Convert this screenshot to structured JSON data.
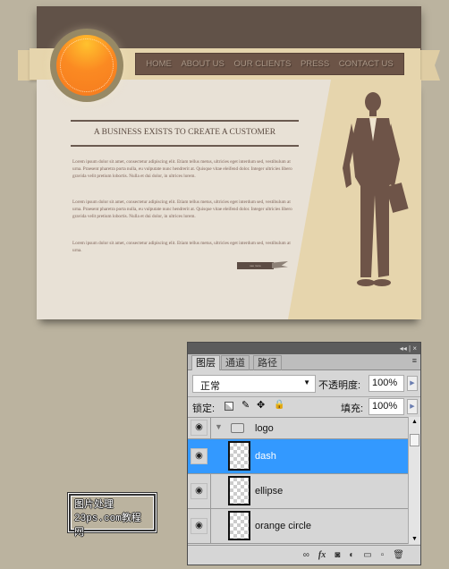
{
  "site": {
    "nav": [
      "HOME",
      "ABOUT US",
      "OUR CLIENTS",
      "PRESS",
      "CONTACT US"
    ],
    "heading": "A BUSINESS EXISTS TO CREATE A CUSTOMER",
    "paragraphs": [
      "Lorem ipsum dolor sit amet, consectetur adipiscing elit. Etiam tellus metus, ultricies eget interdum sed, vestibulum at urna. Praesent pharetra porta nulla, eu vulputate nunc hendrerit at. Quisque vitae eleifend dolor. Integer ultricies libero gravida velit pretium lobortis. Nulla et dui dolor, in ultrices lorem.",
      "Lorem ipsum dolor sit amet, consectetur adipiscing elit. Etiam tellus metus, ultricies eget interdum sed, vestibulum at urna. Praesent pharetra porta nulla, eu vulputate nunc hendrerit at. Quisque vitae eleifend dolor. Integer ultricies libero gravida velit pretium lobortis. Nulla et dui dolor, in ultrices lorem.",
      "Lorem ipsum dolor sit amet, consectetur adipiscing elit. Etiam tellus metus, ultricies eget interdum sed, vestibulum at urna."
    ],
    "button": "see more",
    "colors": {
      "header": "#615248",
      "ribbon": "#e6d5ad",
      "body": "#e8e1d6",
      "logo": "#f98522"
    }
  },
  "panel": {
    "titlebar": "◂◂ | ×",
    "tabs": [
      "图层",
      "通道",
      "路径"
    ],
    "menu_icon": "≡",
    "blend_mode": "正常",
    "opacity_label": "不透明度:",
    "opacity": "100%",
    "lock_label": "锁定:",
    "lock_icons": [
      "transparent-pixels",
      "brush",
      "move",
      "lock"
    ],
    "fill_label": "填充:",
    "fill": "100%",
    "layers": [
      {
        "name": "logo",
        "type": "group",
        "visible": true
      },
      {
        "name": "dash",
        "type": "layer",
        "visible": true,
        "selected": true
      },
      {
        "name": "ellipse",
        "type": "layer",
        "visible": true
      },
      {
        "name": "orange circle",
        "type": "layer",
        "visible": true
      }
    ],
    "bottom_icons": [
      "link",
      "fx",
      "mask",
      "adjustment",
      "group",
      "new-layer",
      "trash"
    ],
    "fx_label": "fx",
    "selected_color": "#3399ff"
  },
  "watermark": {
    "line1": "图片处理",
    "line2": "23ps.com",
    "line3": "教程网"
  }
}
